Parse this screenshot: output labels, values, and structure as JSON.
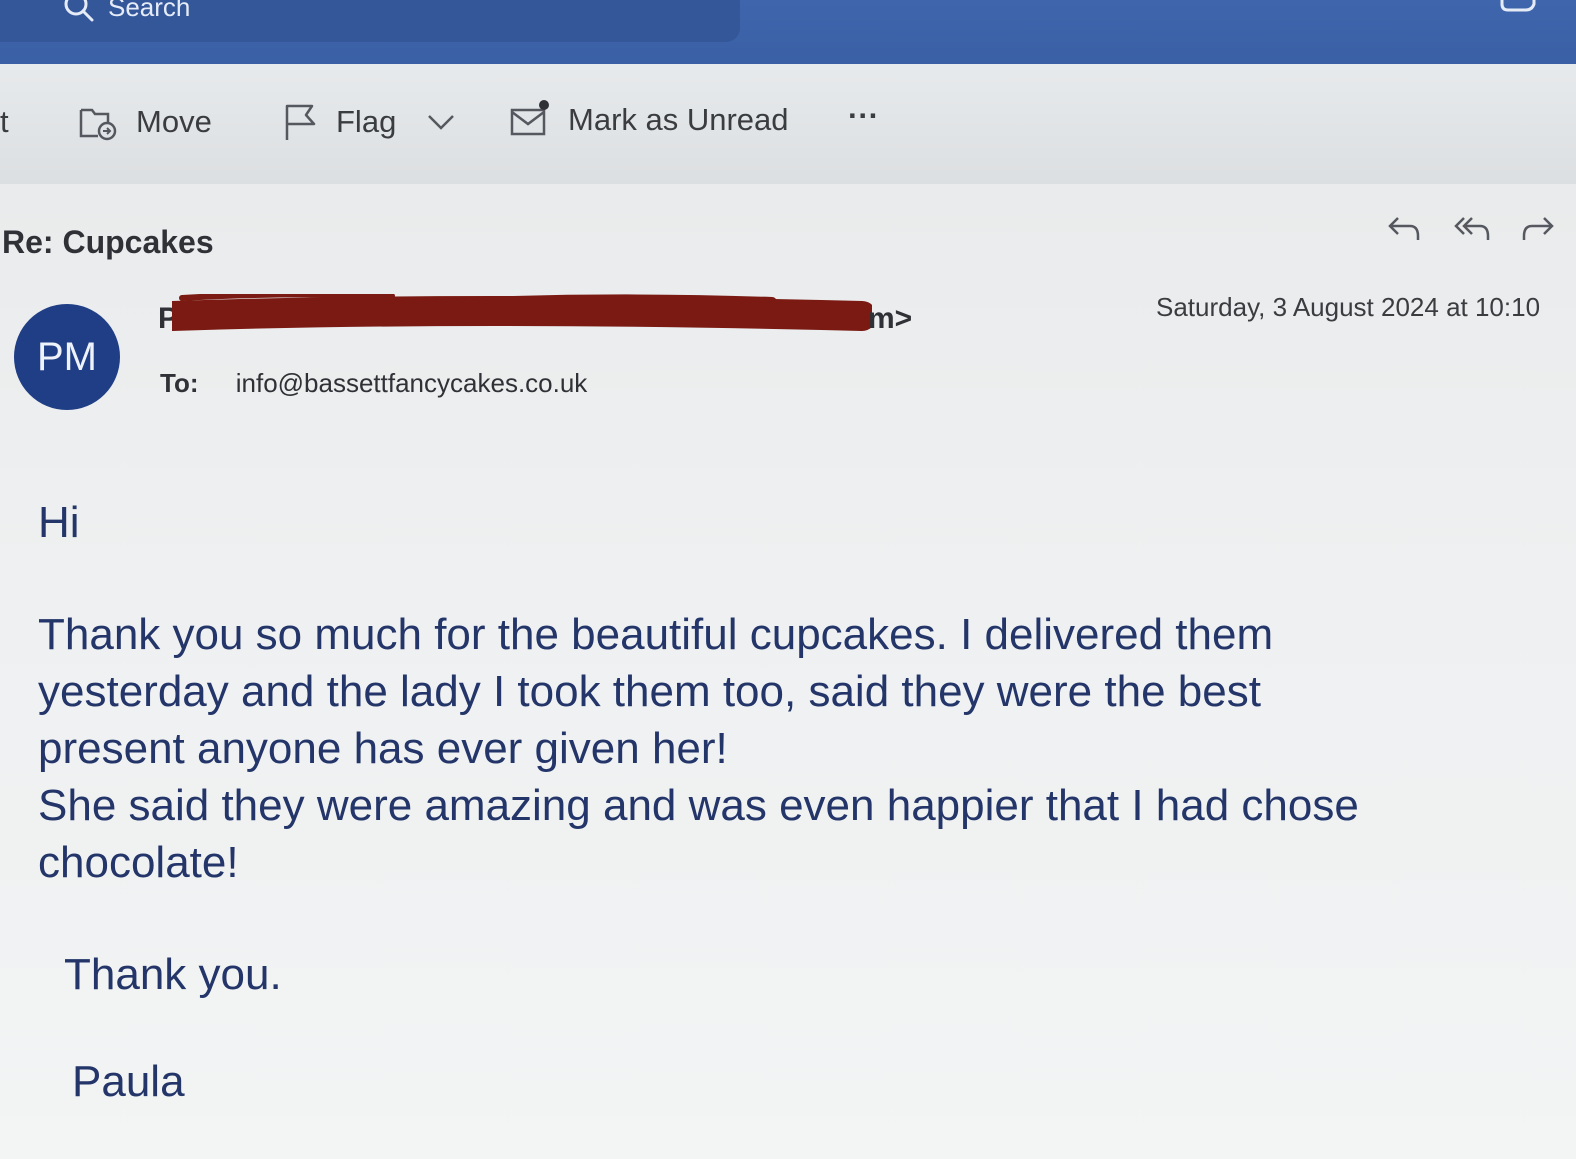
{
  "search": {
    "label": "Search"
  },
  "toolbar": {
    "cut_label": "t",
    "move_label": "Move",
    "flag_label": "Flag",
    "mark_unread_label": "Mark as Unread",
    "more_label": "···"
  },
  "message": {
    "subject": "Re: Cupcakes",
    "avatar_initials": "PM",
    "sender_visible_start": "P",
    "sender_visible_end": "m>",
    "date": "Saturday, 3 August 2024 at 10:10",
    "to_label": "To:",
    "to_address": "info@bassettfancycakes.co.uk",
    "body": {
      "greeting": "Hi",
      "lines": [
        "Thank you so much for the beautiful cupcakes.  I delivered them",
        "yesterday and the lady I took them too, said they were the best",
        "present anyone has ever given her!",
        "She said they were amazing and was even happier that I had chose",
        "chocolate!"
      ],
      "signoff": "Thank you.",
      "signature": "Paula"
    }
  },
  "icons": {
    "search": "search-icon",
    "move": "folder-move-icon",
    "flag": "flag-icon",
    "dropdown": "chevron-down-icon",
    "mark_unread": "envelope-unread-icon",
    "reply": "reply-icon",
    "reply_all": "reply-all-icon",
    "forward": "forward-icon"
  },
  "colors": {
    "topbar": "#3a5fa5",
    "avatar": "#1f3e86",
    "body_text": "#233569",
    "redaction": "#7a1a12"
  }
}
